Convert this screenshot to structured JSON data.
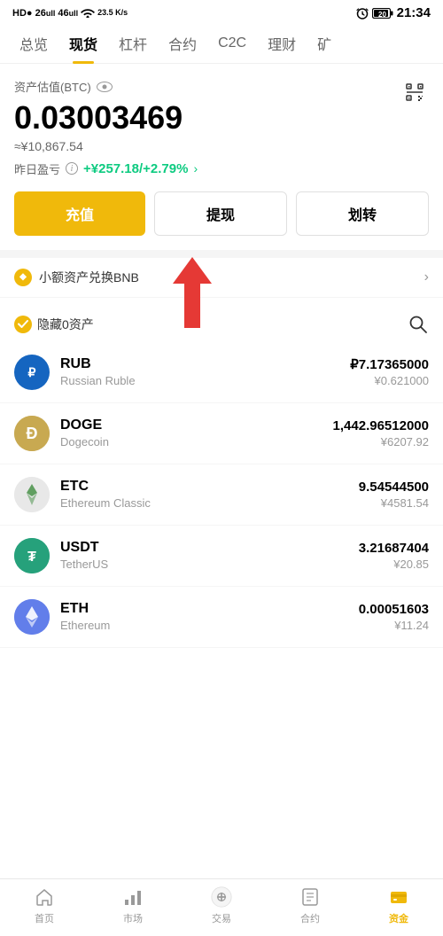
{
  "statusBar": {
    "left": "HD● 26.ull 46.ull",
    "speed": "23.5\nK/s",
    "time": "21:34"
  },
  "navTabs": {
    "items": [
      "总览",
      "现货",
      "杠杆",
      "合约",
      "C2C",
      "理财",
      "矿"
    ],
    "activeIndex": 1
  },
  "assetSection": {
    "label": "资产估值(BTC)",
    "btcAmount": "0.03003469",
    "approx": "≈¥10,867.54",
    "pnlLabel": "昨日盈亏",
    "pnlValue": "+¥257.18/+2.79%"
  },
  "buttons": {
    "deposit": "充值",
    "withdraw": "提现",
    "transfer": "划转"
  },
  "bnbBanner": {
    "text": "小额资产兑换BNB"
  },
  "assetListHeader": {
    "hideLabel": "隐藏0资产"
  },
  "assets": [
    {
      "symbol": "RUB",
      "name": "Russian Ruble",
      "cryptoAmount": "₽7.17365000",
      "fiatAmount": "¥0.621000",
      "iconType": "rub",
      "iconChar": "₽"
    },
    {
      "symbol": "DOGE",
      "name": "Dogecoin",
      "cryptoAmount": "1,442.96512000",
      "fiatAmount": "¥6207.92",
      "iconType": "doge",
      "iconChar": "Ð"
    },
    {
      "symbol": "ETC",
      "name": "Ethereum Classic",
      "cryptoAmount": "9.54544500",
      "fiatAmount": "¥4581.54",
      "iconType": "etc",
      "iconChar": "◆"
    },
    {
      "symbol": "USDT",
      "name": "TetherUS",
      "cryptoAmount": "3.21687404",
      "fiatAmount": "¥20.85",
      "iconType": "usdt",
      "iconChar": "₮"
    },
    {
      "symbol": "ETH",
      "name": "Ethereum",
      "cryptoAmount": "0.00051603",
      "fiatAmount": "¥11.24",
      "iconType": "eth",
      "iconChar": "Ξ"
    }
  ],
  "bottomNav": {
    "items": [
      "首页",
      "市场",
      "交易",
      "合约",
      "资金"
    ],
    "activeIndex": 4
  }
}
